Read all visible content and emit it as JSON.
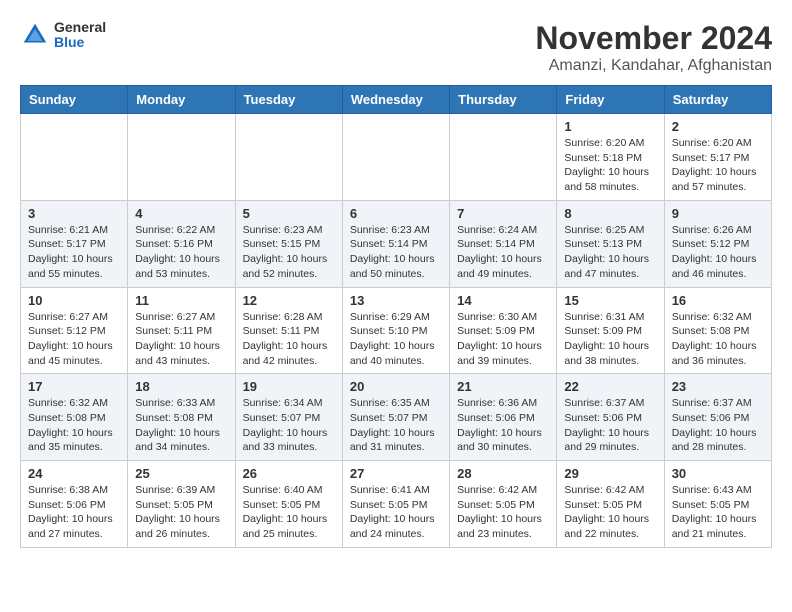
{
  "header": {
    "logo_general": "General",
    "logo_blue": "Blue",
    "month_title": "November 2024",
    "location": "Amanzi, Kandahar, Afghanistan"
  },
  "weekdays": [
    "Sunday",
    "Monday",
    "Tuesday",
    "Wednesday",
    "Thursday",
    "Friday",
    "Saturday"
  ],
  "weeks": [
    [
      {
        "day": "",
        "info": ""
      },
      {
        "day": "",
        "info": ""
      },
      {
        "day": "",
        "info": ""
      },
      {
        "day": "",
        "info": ""
      },
      {
        "day": "",
        "info": ""
      },
      {
        "day": "1",
        "info": "Sunrise: 6:20 AM\nSunset: 5:18 PM\nDaylight: 10 hours\nand 58 minutes."
      },
      {
        "day": "2",
        "info": "Sunrise: 6:20 AM\nSunset: 5:17 PM\nDaylight: 10 hours\nand 57 minutes."
      }
    ],
    [
      {
        "day": "3",
        "info": "Sunrise: 6:21 AM\nSunset: 5:17 PM\nDaylight: 10 hours\nand 55 minutes."
      },
      {
        "day": "4",
        "info": "Sunrise: 6:22 AM\nSunset: 5:16 PM\nDaylight: 10 hours\nand 53 minutes."
      },
      {
        "day": "5",
        "info": "Sunrise: 6:23 AM\nSunset: 5:15 PM\nDaylight: 10 hours\nand 52 minutes."
      },
      {
        "day": "6",
        "info": "Sunrise: 6:23 AM\nSunset: 5:14 PM\nDaylight: 10 hours\nand 50 minutes."
      },
      {
        "day": "7",
        "info": "Sunrise: 6:24 AM\nSunset: 5:14 PM\nDaylight: 10 hours\nand 49 minutes."
      },
      {
        "day": "8",
        "info": "Sunrise: 6:25 AM\nSunset: 5:13 PM\nDaylight: 10 hours\nand 47 minutes."
      },
      {
        "day": "9",
        "info": "Sunrise: 6:26 AM\nSunset: 5:12 PM\nDaylight: 10 hours\nand 46 minutes."
      }
    ],
    [
      {
        "day": "10",
        "info": "Sunrise: 6:27 AM\nSunset: 5:12 PM\nDaylight: 10 hours\nand 45 minutes."
      },
      {
        "day": "11",
        "info": "Sunrise: 6:27 AM\nSunset: 5:11 PM\nDaylight: 10 hours\nand 43 minutes."
      },
      {
        "day": "12",
        "info": "Sunrise: 6:28 AM\nSunset: 5:11 PM\nDaylight: 10 hours\nand 42 minutes."
      },
      {
        "day": "13",
        "info": "Sunrise: 6:29 AM\nSunset: 5:10 PM\nDaylight: 10 hours\nand 40 minutes."
      },
      {
        "day": "14",
        "info": "Sunrise: 6:30 AM\nSunset: 5:09 PM\nDaylight: 10 hours\nand 39 minutes."
      },
      {
        "day": "15",
        "info": "Sunrise: 6:31 AM\nSunset: 5:09 PM\nDaylight: 10 hours\nand 38 minutes."
      },
      {
        "day": "16",
        "info": "Sunrise: 6:32 AM\nSunset: 5:08 PM\nDaylight: 10 hours\nand 36 minutes."
      }
    ],
    [
      {
        "day": "17",
        "info": "Sunrise: 6:32 AM\nSunset: 5:08 PM\nDaylight: 10 hours\nand 35 minutes."
      },
      {
        "day": "18",
        "info": "Sunrise: 6:33 AM\nSunset: 5:08 PM\nDaylight: 10 hours\nand 34 minutes."
      },
      {
        "day": "19",
        "info": "Sunrise: 6:34 AM\nSunset: 5:07 PM\nDaylight: 10 hours\nand 33 minutes."
      },
      {
        "day": "20",
        "info": "Sunrise: 6:35 AM\nSunset: 5:07 PM\nDaylight: 10 hours\nand 31 minutes."
      },
      {
        "day": "21",
        "info": "Sunrise: 6:36 AM\nSunset: 5:06 PM\nDaylight: 10 hours\nand 30 minutes."
      },
      {
        "day": "22",
        "info": "Sunrise: 6:37 AM\nSunset: 5:06 PM\nDaylight: 10 hours\nand 29 minutes."
      },
      {
        "day": "23",
        "info": "Sunrise: 6:37 AM\nSunset: 5:06 PM\nDaylight: 10 hours\nand 28 minutes."
      }
    ],
    [
      {
        "day": "24",
        "info": "Sunrise: 6:38 AM\nSunset: 5:06 PM\nDaylight: 10 hours\nand 27 minutes."
      },
      {
        "day": "25",
        "info": "Sunrise: 6:39 AM\nSunset: 5:05 PM\nDaylight: 10 hours\nand 26 minutes."
      },
      {
        "day": "26",
        "info": "Sunrise: 6:40 AM\nSunset: 5:05 PM\nDaylight: 10 hours\nand 25 minutes."
      },
      {
        "day": "27",
        "info": "Sunrise: 6:41 AM\nSunset: 5:05 PM\nDaylight: 10 hours\nand 24 minutes."
      },
      {
        "day": "28",
        "info": "Sunrise: 6:42 AM\nSunset: 5:05 PM\nDaylight: 10 hours\nand 23 minutes."
      },
      {
        "day": "29",
        "info": "Sunrise: 6:42 AM\nSunset: 5:05 PM\nDaylight: 10 hours\nand 22 minutes."
      },
      {
        "day": "30",
        "info": "Sunrise: 6:43 AM\nSunset: 5:05 PM\nDaylight: 10 hours\nand 21 minutes."
      }
    ]
  ]
}
